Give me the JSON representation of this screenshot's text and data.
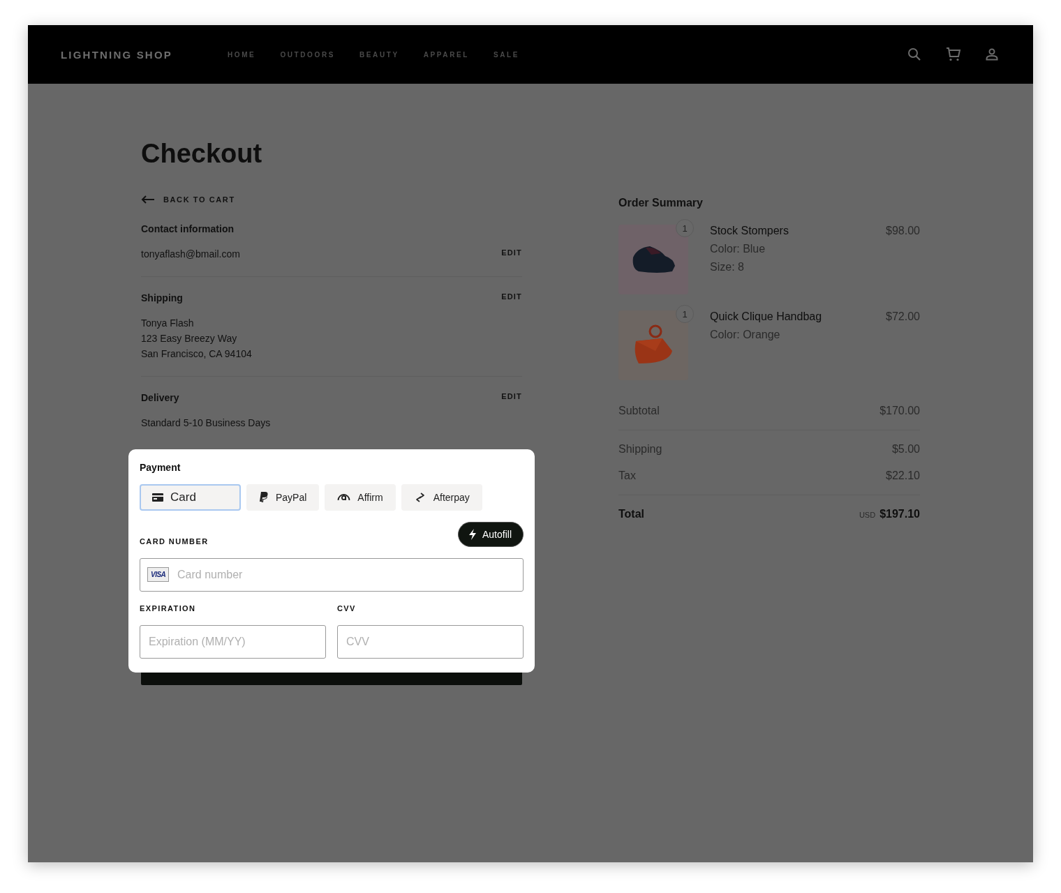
{
  "header": {
    "brand": "LIGHTNING SHOP",
    "nav": [
      {
        "label": "HOME"
      },
      {
        "label": "OUTDOORS"
      },
      {
        "label": "BEAUTY"
      },
      {
        "label": "APPAREL"
      },
      {
        "label": "SALE"
      }
    ]
  },
  "title": "Checkout",
  "back_link": "BACK TO CART",
  "sections": [
    {
      "title": "Contact information",
      "edit": "EDIT",
      "lines": [
        "tonyaflash@bmail.com"
      ],
      "edit_inline": true
    },
    {
      "title": "Shipping",
      "edit": "EDIT",
      "lines": [
        "Tonya Flash",
        "123 Easy Breezy Way",
        "San Francisco, CA 94104"
      ],
      "edit_inline": false
    },
    {
      "title": "Delivery",
      "edit": "EDIT",
      "lines": [
        "Standard 5-10 Business Days"
      ],
      "edit_inline": false
    }
  ],
  "payment": {
    "title": "Payment",
    "methods": [
      {
        "label": "Card",
        "kind": "card",
        "selected": true
      },
      {
        "label": "PayPal",
        "kind": "paypal",
        "selected": false
      },
      {
        "label": "Affirm",
        "kind": "affirm",
        "selected": false
      },
      {
        "label": "Afterpay",
        "kind": "afterpay",
        "selected": false
      }
    ],
    "autofill": "Autofill",
    "card_number_label": "CARD NUMBER",
    "card_brand": "VISA",
    "card_number": {
      "placeholder": "Card number"
    },
    "expiration_label": "EXPIRATION",
    "expiration": {
      "placeholder": "Expiration (MM/YY)"
    },
    "cvv_label": "CVV",
    "cvv": {
      "placeholder": "CVV"
    }
  },
  "order_summary": {
    "title": "Order Summary",
    "items": [
      {
        "name": "Stock Stompers",
        "price": "$98.00",
        "quantity": "1",
        "details": [
          "Color: Blue",
          "Size: 8"
        ],
        "kind": "shoe"
      },
      {
        "name": "Quick Clique Handbag",
        "price": "$72.00",
        "quantity": "1",
        "details": [
          "Color: Orange"
        ],
        "kind": "handbag"
      }
    ],
    "subtotal": {
      "label": "Subtotal",
      "value": "$170.00"
    },
    "charges": [
      {
        "label": "Shipping",
        "value": "$5.00"
      },
      {
        "label": "Tax",
        "value": "$22.10"
      }
    ],
    "total": {
      "label": "Total",
      "currency": "USD",
      "value": "$197.10"
    }
  }
}
